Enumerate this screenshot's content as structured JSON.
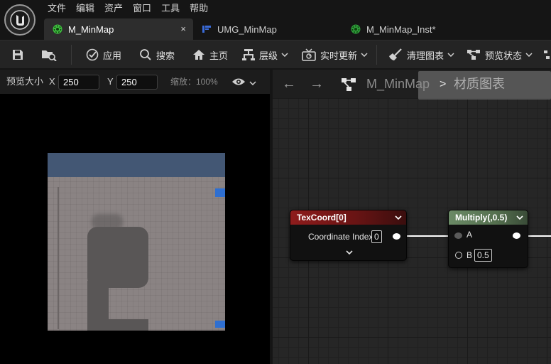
{
  "menu": {
    "items": [
      "文件",
      "编辑",
      "资产",
      "窗口",
      "工具",
      "帮助"
    ]
  },
  "tabs": [
    {
      "label": "M_MinMap",
      "icon": "material-icon",
      "color": "#3fbf3f"
    },
    {
      "label": "UMG_MinMap",
      "icon": "widget-blueprint-icon",
      "color": "#3a6bd8"
    },
    {
      "label": "M_MinMap_Inst*",
      "icon": "material-instance-icon",
      "color": "#2e9e3a"
    }
  ],
  "tab_close": "×",
  "toolbar": {
    "apply": "应用",
    "search": "搜索",
    "home": "主页",
    "hierarchy": "层级",
    "live_update": "实时更新",
    "clean_graph": "清理图表",
    "preview_state": "预览状态"
  },
  "preview": {
    "size_label": "预览大小",
    "x_label": "X",
    "x_value": "250",
    "y_label": "Y",
    "y_value": "250",
    "zoom": "缩放：100%"
  },
  "graph": {
    "back_arrow": "←",
    "forward_arrow": "→",
    "crumb_root": "M_MinMap",
    "crumb_sep": ">",
    "crumb_current": "材质图表"
  },
  "nodes": {
    "texcoord": {
      "title": "TexCoord[0]",
      "pin_label": "Coordinate Index",
      "pin_value": "0",
      "title_color": "#8e1c1c"
    },
    "multiply": {
      "title": "Multiply(,0.5)",
      "pin_a": "A",
      "pin_b": "B",
      "pin_b_value": "0.5",
      "title_color": "#5e7a5a"
    }
  },
  "colors": {
    "accent": "#2f7de1",
    "minimap_top": "#435774",
    "minimap_ground": "#8a8383"
  }
}
